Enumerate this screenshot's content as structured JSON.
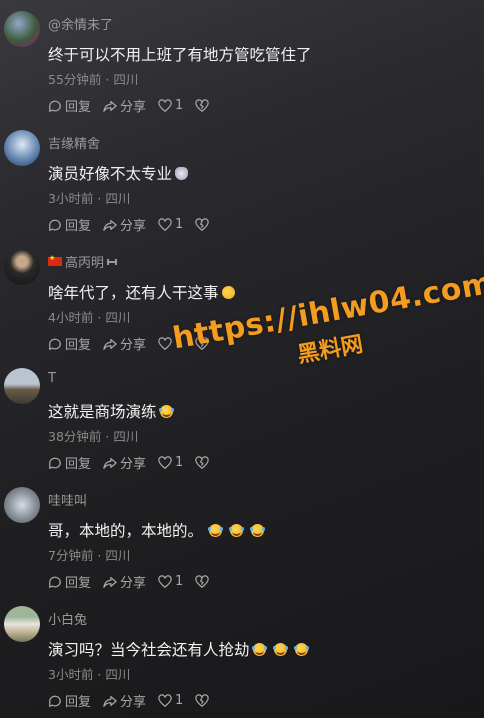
{
  "actions": {
    "reply": "回复",
    "share": "分享"
  },
  "comments": [
    {
      "username": "@余情未了",
      "text": "终于可以不用上班了有地方管吃管住了",
      "meta": "55分钟前 · 四川",
      "likes": "1"
    },
    {
      "username": "吉缘精舍",
      "text": "演员好像不太专业",
      "meta": "3小时前 · 四川",
      "likes": "1"
    },
    {
      "username": "高丙明",
      "text": "啥年代了，还有人干这事",
      "meta": "4小时前 · 四川",
      "likes": "1"
    },
    {
      "username": "T",
      "text": "这就是商场演练",
      "meta": "38分钟前 · 四川",
      "likes": "1"
    },
    {
      "username": "哇哇叫",
      "text": "哥，本地的，本地的。",
      "meta": "7分钟前 · 四川",
      "likes": "1"
    },
    {
      "username": "小白兔",
      "text": "演习吗？当今社会还有人抢劫",
      "meta": "3小时前 · 四川",
      "likes": "1"
    }
  ],
  "watermark": {
    "url": "https://ihlw04.com",
    "sub": "黑料网"
  },
  "colors": {
    "watermark": "#f39c1f",
    "background": "#1f1f22"
  }
}
